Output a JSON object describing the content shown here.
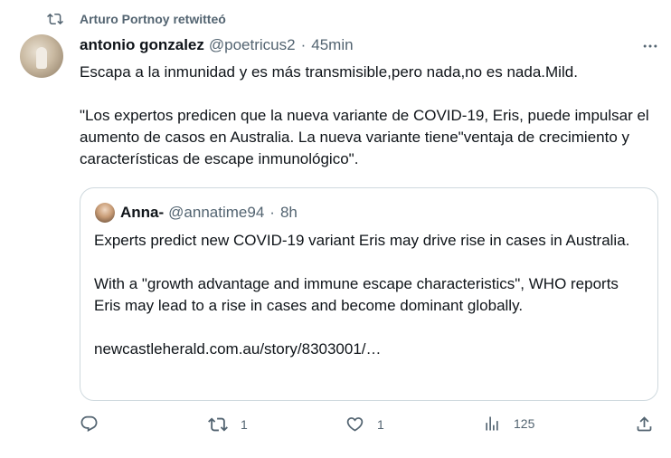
{
  "retweet": {
    "text": "Arturo Portnoy retwitteó"
  },
  "tweet": {
    "author_name": "antonio gonzalez",
    "author_handle": "@poetricus2",
    "separator": "·",
    "time": "45min",
    "text_paragraph_1": "Escapa a la inmunidad y es más transmisible,pero nada,no es nada.Mild.",
    "text_paragraph_2": "\"Los expertos predicen que la nueva variante de COVID-19, Eris, puede impulsar el aumento de casos en Australia. La nueva variante tiene\"ventaja de crecimiento y características de escape inmunológico\"."
  },
  "quote": {
    "author_name": "Anna-",
    "author_handle": "@annatime94",
    "separator": "·",
    "time": "8h",
    "paragraph_1": "Experts predict new COVID-19 variant Eris may drive rise in cases in Australia.",
    "paragraph_2": "With a \"growth advantage and immune escape characteristics\", WHO reports Eris may lead to a rise in cases and become dominant globally.",
    "link": "newcastleherald.com.au/story/8303001/…"
  },
  "actions": {
    "reply_count": "",
    "retweet_count": "1",
    "like_count": "1",
    "views_count": "125"
  },
  "colors": {
    "text_primary": "#0f1419",
    "text_secondary": "#536471",
    "border": "#cfd9de"
  },
  "icons": [
    "retweet-icon",
    "more-icon",
    "reply-icon",
    "retweet-icon",
    "like-icon",
    "views-icon",
    "share-icon"
  ]
}
